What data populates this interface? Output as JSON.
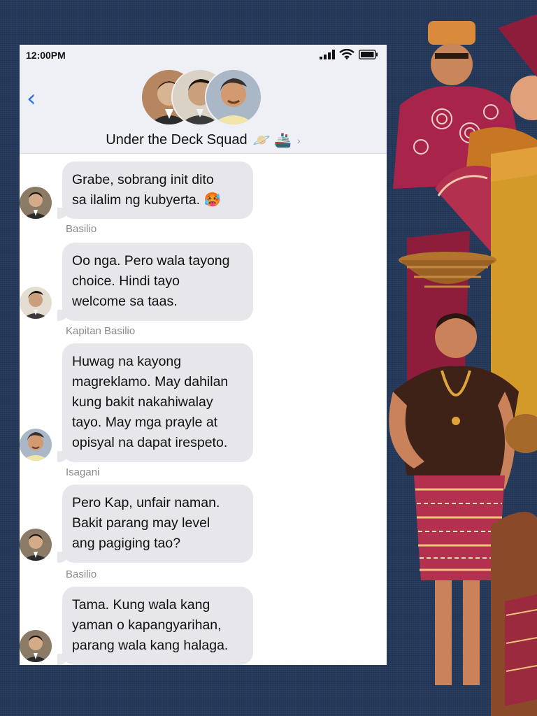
{
  "status_bar": {
    "time": "12:00PM"
  },
  "header": {
    "back_glyph": "‹",
    "title": "Under the Deck Squad",
    "title_emojis": "🪐 🚢",
    "chevron": "›",
    "avatars": [
      "avatar-basilio",
      "avatar-isagani",
      "avatar-kapitan-basilio"
    ]
  },
  "messages": [
    {
      "sender": "",
      "text_lines": [
        "Grabe, sobrang init dito",
        "sa ilalim ng kubyerta. 🥵"
      ],
      "avatar": "avatar-isagani"
    },
    {
      "sender": "Basilio",
      "text_lines": [
        "Oo nga. Pero wala tayong",
        "choice. Hindi tayo",
        "welcome sa taas."
      ],
      "avatar": "avatar-basilio"
    },
    {
      "sender": "Kapitan Basilio",
      "text_lines": [
        "Huwag na kayong",
        "magreklamo. May dahilan",
        "kung bakit nakahiwalay",
        "tayo. May mga prayle at",
        "opisyal na dapat irespeto."
      ],
      "avatar": "avatar-kapitan-basilio"
    },
    {
      "sender": "Isagani",
      "text_lines": [
        "Pero Kap, unfair naman.",
        "Bakit parang may level",
        "ang pagiging tao?"
      ],
      "avatar": "avatar-isagani"
    },
    {
      "sender": "Basilio",
      "text_lines": [
        "Tama. Kung wala kang",
        "yaman o kapangyarihan,",
        "parang wala kang halaga."
      ],
      "avatar": "avatar-isagani"
    }
  ],
  "colors": {
    "background": "#24385a",
    "header_bg": "#eef0f5",
    "bubble_bg": "#e6e6eb",
    "accent": "#2f6fe0",
    "sender_text": "#8a8a8a"
  }
}
